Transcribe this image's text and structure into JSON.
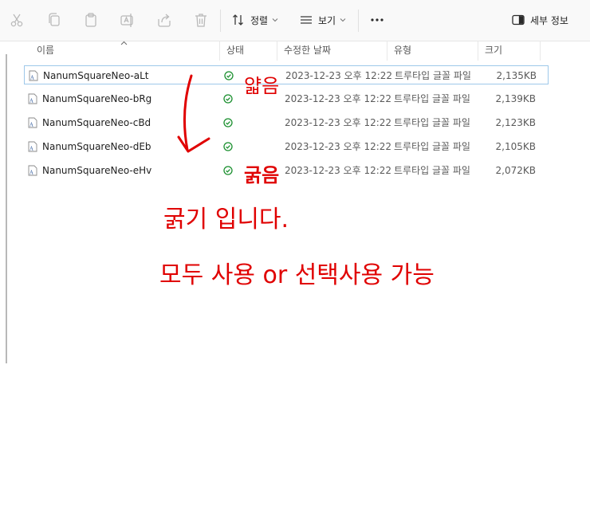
{
  "toolbar": {
    "sort_label": "정렬",
    "view_label": "보기",
    "details_label": "세부 정보",
    "icons": [
      "cut-icon",
      "copy-icon",
      "paste-icon",
      "rename-icon",
      "share-icon",
      "delete-icon",
      "sort-icon",
      "view-icon",
      "more-icon",
      "details-pane-icon"
    ]
  },
  "columns": {
    "name": "이름",
    "status": "상태",
    "modified": "수정한 날짜",
    "type": "유형",
    "size": "크기"
  },
  "files": [
    {
      "name": "NanumSquareNeo-aLt",
      "modified": "2023-12-23 오후 12:22",
      "type": "트루타입 글꼴 파일",
      "size": "2,135KB"
    },
    {
      "name": "NanumSquareNeo-bRg",
      "modified": "2023-12-23 오후 12:22",
      "type": "트루타입 글꼴 파일",
      "size": "2,139KB"
    },
    {
      "name": "NanumSquareNeo-cBd",
      "modified": "2023-12-23 오후 12:22",
      "type": "트루타입 글꼴 파일",
      "size": "2,123KB"
    },
    {
      "name": "NanumSquareNeo-dEb",
      "modified": "2023-12-23 오후 12:22",
      "type": "트루타입 글꼴 파일",
      "size": "2,105KB"
    },
    {
      "name": "NanumSquareNeo-eHv",
      "modified": "2023-12-23 오후 12:22",
      "type": "트루타입 글꼴 파일",
      "size": "2,072KB"
    }
  ],
  "annotations": {
    "top_label": "얇음",
    "bottom_label": "굵음",
    "line1": "굵기 입니다.",
    "line2": "모두 사용 or 선택사용 가능",
    "ink_color": "#e00000"
  },
  "colors": {
    "status_ok": "#1a8f2e",
    "selection_border": "#9ec8ea"
  }
}
